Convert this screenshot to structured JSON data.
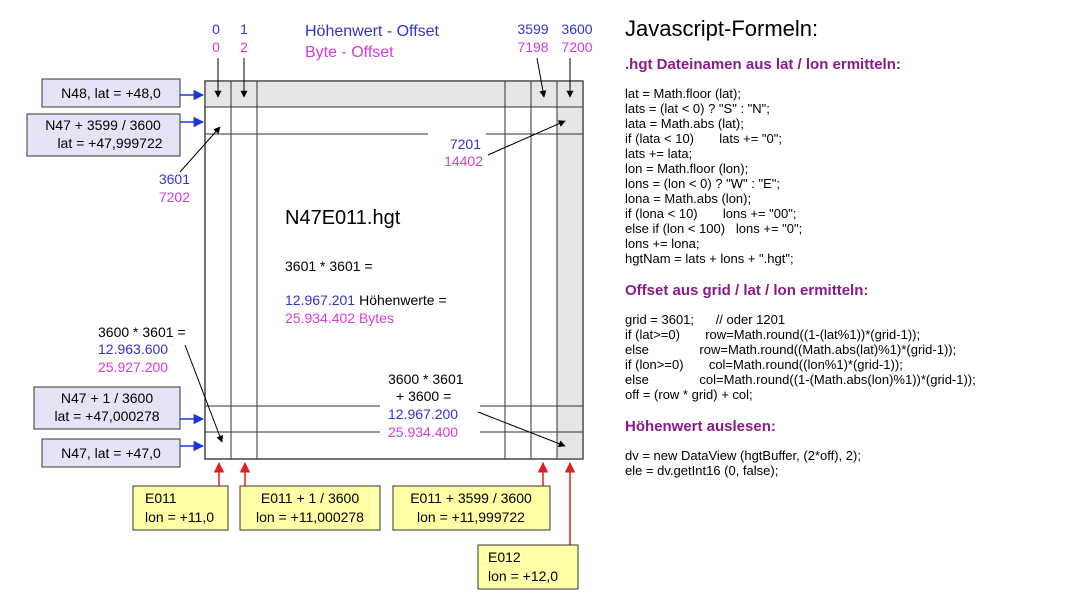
{
  "colors": {
    "blue": "#3333cc",
    "magenta": "#d93ad9",
    "red": "#e02020",
    "arrowBlue": "#1a35e0",
    "yellow": "#ffffa6",
    "lavender": "#e4e4f7",
    "gray": "#e6e6e6"
  },
  "diagram": {
    "top_offsets": [
      {
        "h": "0",
        "b": "0"
      },
      {
        "h": "1",
        "b": "2"
      },
      {
        "h": "3599",
        "b": "7198"
      },
      {
        "h": "3600",
        "b": "7200"
      }
    ],
    "legend": {
      "hoehenwert": "Höhenwert - Offset",
      "byte": "Byte - Offset"
    },
    "filename": "N47E011.hgt",
    "product": "3601 * 3601 =",
    "hoehenwerte_num": "12.967.201",
    "hoehenwerte_label": "Höhenwerte =",
    "bytes_total": "25.934.402 Bytes",
    "row1_right": {
      "h": "7201",
      "b": "14402"
    },
    "row1_left": {
      "h": "3601",
      "b": "7202"
    },
    "lastrow_left": {
      "label": "3600 * 3601 =",
      "h": "12.963.600",
      "b": "25.927.200"
    },
    "lastcell": {
      "label1": "3600 * 3601",
      "label2": "+ 3600 =",
      "h": "12.967.200",
      "b": "25.934.400"
    },
    "left_boxes": [
      {
        "l1": "N48, lat = +48,0",
        "l2": ""
      },
      {
        "l1": "N47 + 3599 / 3600",
        "l2": "lat = +47,999722"
      },
      {
        "l1": "N47 + 1 / 3600",
        "l2": "lat = +47,000278"
      },
      {
        "l1": "N47, lat = +47,0",
        "l2": ""
      }
    ],
    "bottom_boxes": [
      {
        "l1": "E011",
        "l2": "lon = +11,0"
      },
      {
        "l1": "E011 + 1 / 3600",
        "l2": "lon = +11,000278"
      },
      {
        "l1": "E011 + 3599 / 3600",
        "l2": "lon = +11,999722"
      },
      {
        "l1": "E012",
        "l2": "lon = +12,0"
      }
    ]
  },
  "code": {
    "title": "Javascript-Formeln:",
    "sections": [
      {
        "heading": ".hgt Dateinamen aus lat / lon ermitteln:",
        "lines": [
          "lat = Math.floor (lat);",
          "lats = (lat < 0) ? \"S\" : \"N\";",
          "lata = Math.abs (lat);",
          "if (lata < 10)       lats += \"0\";",
          "lats += lata;",
          "lon = Math.floor (lon);",
          "lons = (lon < 0) ? \"W\" : \"E\";",
          "lona = Math.abs (lon);",
          "if (lona < 10)       lons += \"00\";",
          "else if (lon < 100)   lons += \"0\";",
          "lons += lona;",
          "hgtNam = lats + lons + \".hgt\";"
        ]
      },
      {
        "heading": "Offset aus grid / lat / lon ermitteln:",
        "lines": [
          "grid = 3601;      // oder 1201",
          "if (lat>=0)       row=Math.round((1-(lat%1))*(grid-1));",
          "else              row=Math.round((Math.abs(lat)%1)*(grid-1));",
          "if (lon>=0)       col=Math.round((lon%1)*(grid-1));",
          "else              col=Math.round((1-(Math.abs(lon)%1))*(grid-1));",
          "off = (row * grid) + col;"
        ]
      },
      {
        "heading": "Höhenwert auslesen:",
        "lines": [
          "dv = new DataView (hgtBuffer, (2*off), 2);",
          "ele = dv.getInt16 (0, false);"
        ]
      }
    ]
  }
}
